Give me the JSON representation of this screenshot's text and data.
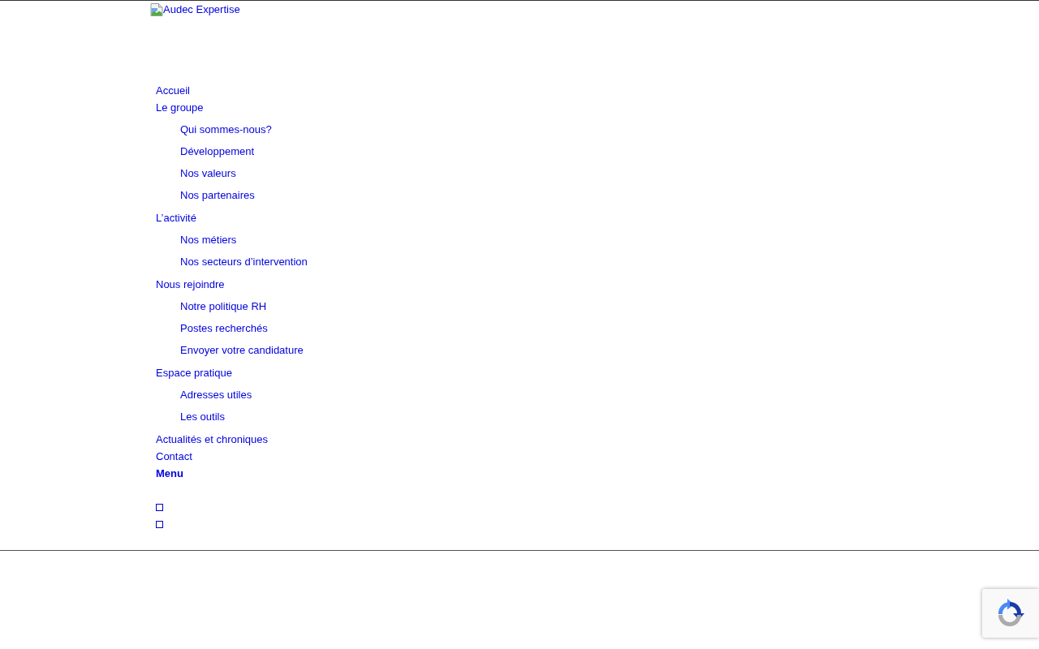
{
  "logo": {
    "alt_text": "Audec Expertise"
  },
  "nav": {
    "items": [
      {
        "label": "Accueil"
      },
      {
        "label": "Le groupe",
        "children": [
          {
            "label": "Qui sommes-nous?"
          },
          {
            "label": "Développement"
          },
          {
            "label": "Nos valeurs"
          },
          {
            "label": "Nos partenaires"
          }
        ]
      },
      {
        "label": "L’activité",
        "children": [
          {
            "label": "Nos métiers"
          },
          {
            "label": "Nos secteurs d’intervention"
          }
        ]
      },
      {
        "label": "Nous rejoindre",
        "children": [
          {
            "label": "Notre politique RH"
          },
          {
            "label": "Postes recherchés"
          },
          {
            "label": "Envoyer votre candidature"
          }
        ]
      },
      {
        "label": "Espace pratique",
        "children": [
          {
            "label": "Adresses utiles"
          },
          {
            "label": "Les outils"
          }
        ]
      },
      {
        "label": "Actualités et chroniques"
      },
      {
        "label": "Contact"
      }
    ],
    "menu_label": "Menu"
  }
}
